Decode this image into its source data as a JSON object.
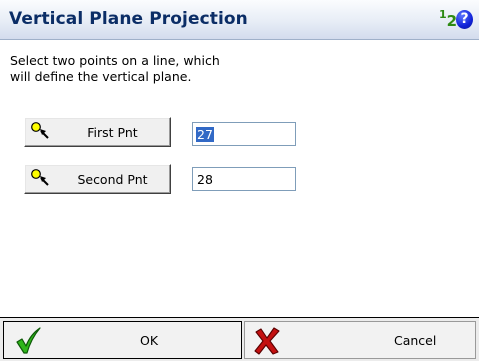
{
  "dialog": {
    "title": "Vertical Plane Projection",
    "instruction_line1": "Select two points on a line, which",
    "instruction_line2": "will define the vertical plane."
  },
  "header_icons": {
    "numeric_keypad_icon": "keypad-123-icon",
    "numeric_keypad_text": "123",
    "help_icon": "help-question-icon",
    "help_text": "?"
  },
  "first_point": {
    "button_label": "First Pnt",
    "icon": "point-pick-icon",
    "value": "27"
  },
  "second_point": {
    "button_label": "Second Pnt",
    "icon": "point-pick-icon",
    "value": "28"
  },
  "footer": {
    "ok_label": "OK",
    "ok_icon": "checkmark-icon",
    "cancel_label": "Cancel",
    "cancel_icon": "cross-icon"
  },
  "colors": {
    "title_text": "#0b2d66",
    "selection": "#3169c6",
    "keypad_green": "#2e8a13",
    "help_blue": "#1022d8",
    "ok_green": "#2fb51a",
    "cancel_red": "#c41010"
  }
}
